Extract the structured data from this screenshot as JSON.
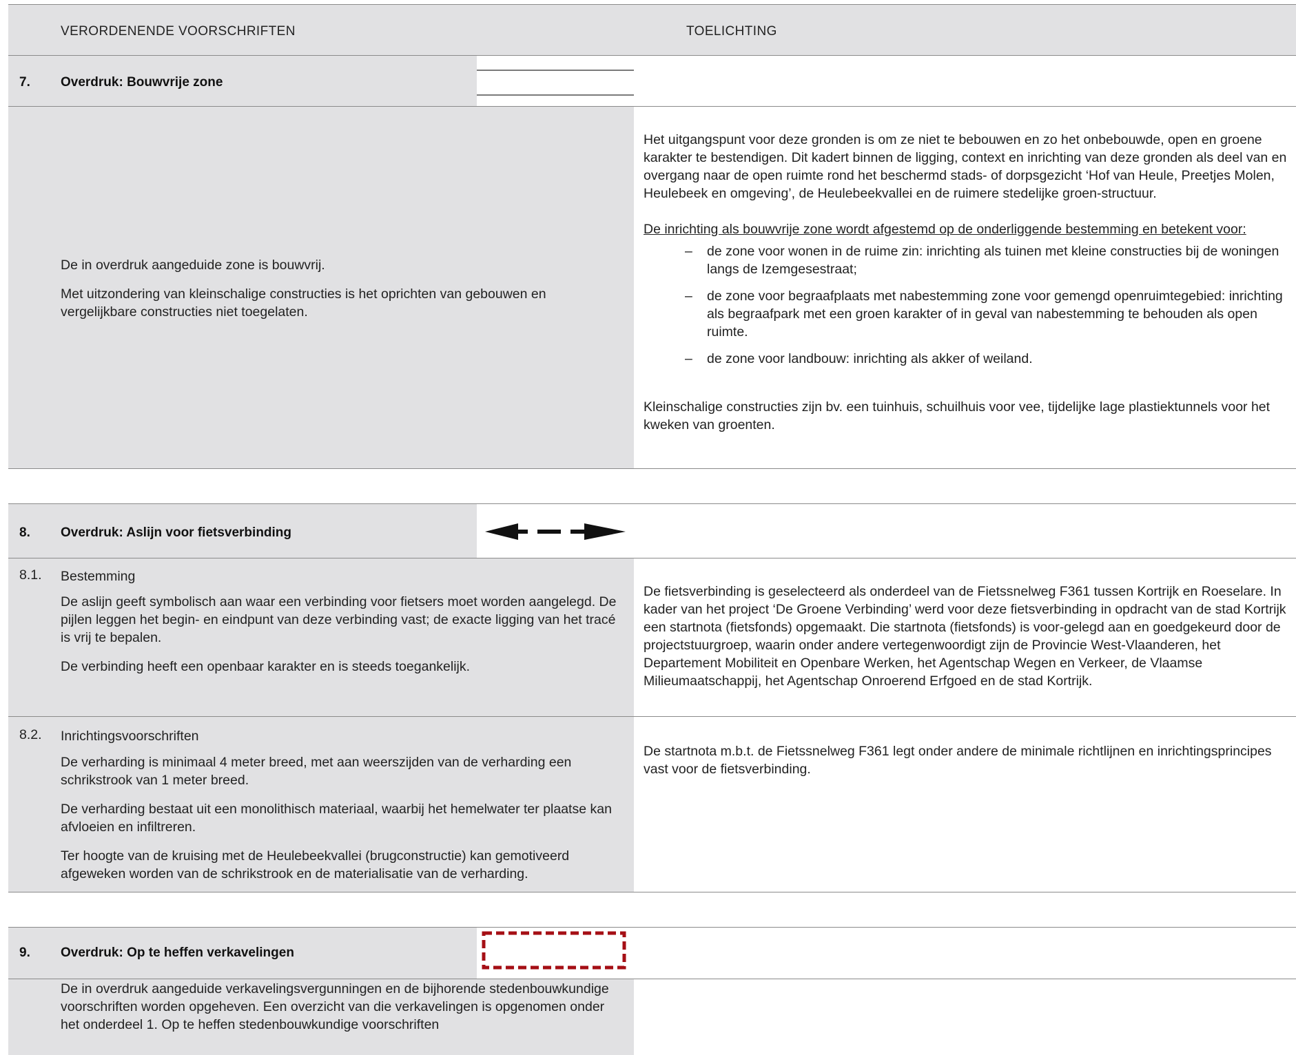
{
  "header": {
    "left_col": "VERORDENENDE VOORSCHRIFTEN",
    "right_col": "TOELICHTING"
  },
  "section7": {
    "num": "7.",
    "title": "Overdruk: Bouwvrije zone",
    "left": [
      "De in overdruk aangeduide zone is bouwvrij.",
      "Met uitzondering van kleinschalige constructies is het oprichten van gebouwen en vergelijkbare constructies niet toegelaten."
    ],
    "right_intro": "Het uitgangspunt voor deze gronden is om ze niet te bebouwen en zo het onbebouwde, open en groene karakter te bestendigen. Dit kadert binnen de ligging, context en inrichting van deze gronden als deel van en overgang naar de open ruimte rond het beschermd stads- of dorpsgezicht ‘Hof van Heule, Preetjes Molen, Heulebeek en omgeving’, de Heulebeekvallei en de ruimere stedelijke groen-structuur.",
    "right_heading": "De inrichting als bouwvrije zone wordt afgestemd op de onderliggende bestemming en betekent voor:",
    "list": [
      "de zone voor wonen in de ruime zin: inrichting als tuinen met kleine constructies bij de woningen langs de Izemgesestraat;",
      "de zone voor begraafplaats met nabestemming zone voor gemengd openruimtegebied: inrichting als begraafpark met een groen karakter of in geval van nabestemming te behouden als open ruimte.",
      "de zone voor landbouw: inrichting als akker of weiland."
    ],
    "right_outro": "Kleinschalige constructies zijn bv. een tuinhuis, schuilhuis voor vee, tijdelijke lage plastiektunnels voor het kweken van groenten."
  },
  "section8": {
    "num": "8.",
    "title": "Overdruk: Aslijn voor fietsverbinding",
    "sub1": {
      "num": "8.1.",
      "title": "Bestemming",
      "p1": "De aslijn geeft symbolisch aan waar een verbinding voor fietsers moet worden aangelegd. De pijlen leggen het begin- en eindpunt van deze verbinding vast; de exacte ligging van het tracé is vrij te bepalen.",
      "p2": "De verbinding heeft een openbaar karakter en is steeds toegankelijk.",
      "right": "De fietsverbinding is geselecteerd als onderdeel van de Fietssnelweg F361 tussen Kortrijk en Roeselare. In kader van het project ‘De Groene Verbinding’ werd voor deze fietsverbinding in opdracht van de stad Kortrijk een startnota (fietsfonds) opgemaakt. Die startnota (fietsfonds) is voor-gelegd aan en goedgekeurd door de projectstuurgroep, waarin onder andere vertegenwoordigt zijn de Provincie West-Vlaanderen, het Departement Mobiliteit en Openbare Werken, het Agentschap Wegen en Verkeer, de Vlaamse Milieumaatschappij, het Agentschap Onroerend Erfgoed en de stad Kortrijk."
    },
    "sub2": {
      "num": "8.2.",
      "title": "Inrichtingsvoorschriften",
      "p1": "De verharding is minimaal 4 meter breed, met aan weerszijden van de verharding een schrikstrook van 1 meter breed.",
      "p2": "De verharding bestaat uit een monolithisch materiaal, waarbij het hemelwater ter plaatse kan afvloeien en infiltreren.",
      "p3": "Ter hoogte van de kruising met de Heulebeekvallei (brugconstructie) kan gemotiveerd afgeweken worden van de schrikstrook en de materialisatie van de verharding.",
      "right": "De startnota m.b.t. de Fietssnelweg F361 legt onder andere de minimale richtlijnen en inrichtingsprincipes vast voor de fietsverbinding."
    }
  },
  "section9": {
    "num": "9.",
    "title": "Overdruk: Op te heffen verkavelingen",
    "left": "De in overdruk aangeduide verkavelingsvergunningen en de bijhorende stedenbouwkundige voorschriften worden opgeheven. Een overzicht  van die verkavelingen is opgenomen onder het onderdeel 1. Op te heffen stedenbouwkundige voorschriften"
  },
  "colors": {
    "panel_grey": "#e1e1e3",
    "rule": "#8a8a8a",
    "dashed_box": "#a50f15"
  }
}
